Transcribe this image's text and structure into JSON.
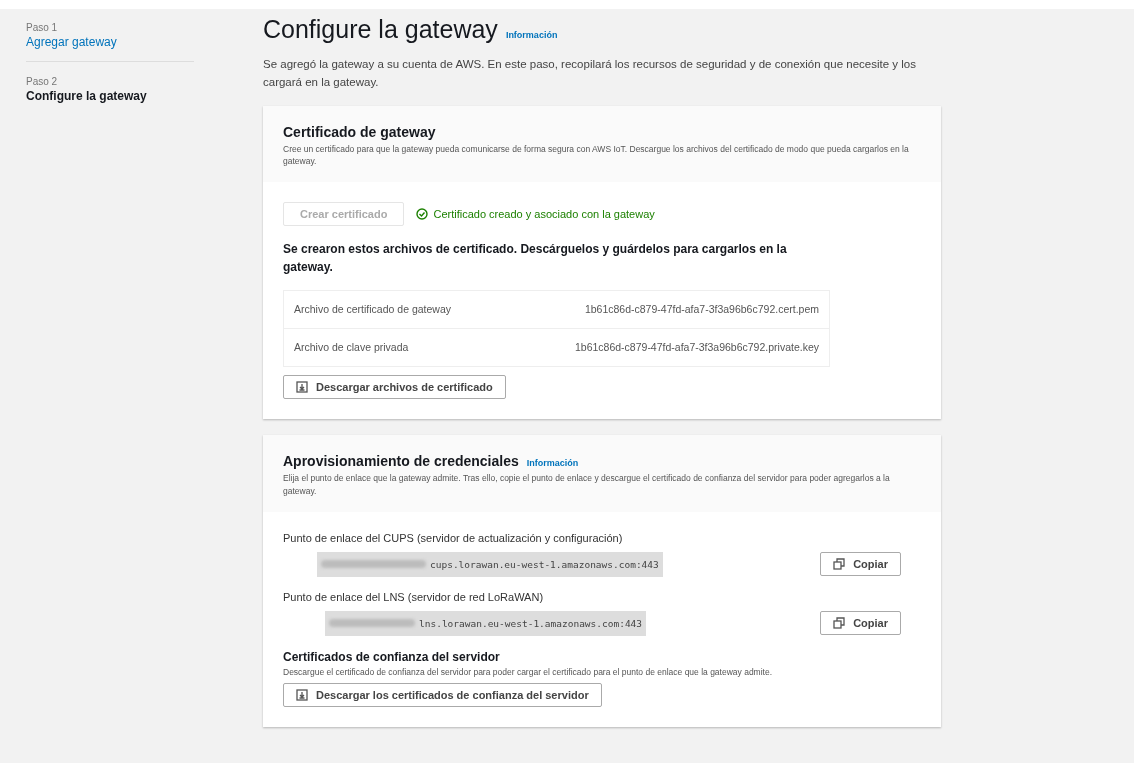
{
  "steps": [
    {
      "number": "Paso 1",
      "label": "Agregar gateway",
      "selected": false
    },
    {
      "number": "Paso 2",
      "label": "Configure la gateway",
      "selected": true
    }
  ],
  "header": {
    "title": "Configure la gateway",
    "info": "Información",
    "description": "Se agregó la gateway a su cuenta de AWS. En este paso, recopilará los recursos de seguridad y de conexión que necesite y los cargará en la gateway."
  },
  "certificate_card": {
    "title": "Certificado de gateway",
    "description": "Cree un certificado para que la gateway pueda comunicarse de forma segura con AWS IoT. Descargue los archivos del certificado de modo que pueda cargarlos en la gateway.",
    "create_button": {
      "label": "Crear certificado",
      "disabled": true
    },
    "status": "Certificado creado y asociado con la gateway",
    "files_note": "Se crearon estos archivos de certificado. Descárguelos y guárdelos para cargarlos en la gateway.",
    "files": [
      {
        "label": "Archivo de certificado de gateway",
        "value": "1b61c86d-c879-47fd-afa7-3f3a96b6c792.cert.pem"
      },
      {
        "label": "Archivo de clave privada",
        "value": "1b61c86d-c879-47fd-afa7-3f3a96b6c792.private.key"
      }
    ],
    "download_button": "Descargar archivos de certificado"
  },
  "credentials_card": {
    "title": "Aprovisionamiento de credenciales",
    "info": "Información",
    "description": "Elija el punto de enlace que la gateway admite. Tras ello, copie el punto de enlace y descargue el certificado de confianza del servidor para poder agregarlos a la gateway.",
    "endpoints": [
      {
        "label": "Punto de enlace del CUPS (servidor de actualización y configuración)",
        "value": "cups.lorawan.eu-west-1.amazonaws.com:443",
        "copy_button": "Copiar"
      },
      {
        "label": "Punto de enlace del LNS (servidor de red LoRaWAN)",
        "value": "lns.lorawan.eu-west-1.amazonaws.com:443",
        "copy_button": "Copiar"
      }
    ],
    "trust_title": "Certificados de confianza del servidor",
    "trust_description": "Descargue el certificado de confianza del servidor para poder cargar el certificado para el punto de enlace que la gateway admite.",
    "trust_button": "Descargar los certificados de confianza del servidor"
  }
}
